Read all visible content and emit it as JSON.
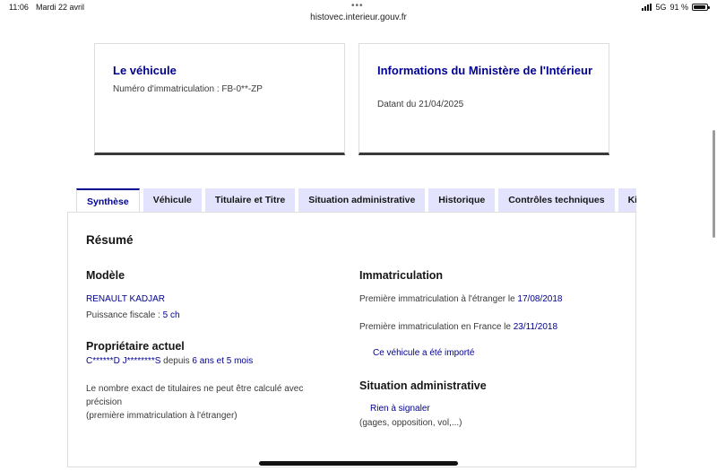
{
  "status_bar": {
    "time": "11:06",
    "date": "Mardi 22 avril",
    "network": "5G",
    "battery": "91 %",
    "battery_level": 0.91
  },
  "browser": {
    "url": "histovec.interieur.gouv.fr",
    "menu_dots": "•••"
  },
  "cards": {
    "vehicle": {
      "title": "Le véhicule",
      "plate": "Numéro d'immatriculation : FB-0**-ZP"
    },
    "ministry": {
      "title": "Informations du Ministère de l'Intérieur",
      "date": "Datant du 21/04/2025"
    }
  },
  "tabs": [
    {
      "label": "Synthèse",
      "active": true
    },
    {
      "label": "Véhicule",
      "active": false
    },
    {
      "label": "Titulaire et Titre",
      "active": false
    },
    {
      "label": "Situation administrative",
      "active": false
    },
    {
      "label": "Historique",
      "active": false
    },
    {
      "label": "Contrôles techniques",
      "active": false
    },
    {
      "label": "Kilo",
      "active": false
    }
  ],
  "summary": {
    "heading": "Résumé",
    "model": {
      "heading": "Modèle",
      "name": "RENAULT KADJAR",
      "power_label": "Puissance fiscale : ",
      "power_value": "5 ch"
    },
    "owner": {
      "heading": "Propriétaire actuel",
      "name": "C******D J********S",
      "since_label": " depuis ",
      "since_value": "6 ans et 5 mois",
      "note_line1": "Le nombre exact de titulaires ne peut être calculé avec",
      "note_line2": "précision",
      "note_line3": "(première immatriculation à l'étranger)"
    },
    "registration": {
      "heading": "Immatriculation",
      "foreign_label": "Première immatriculation à l'étranger le ",
      "foreign_date": "17/08/2018",
      "france_label": "Première immatriculation en France le ",
      "france_date": "23/11/2018",
      "imported": "Ce véhicule a été importé"
    },
    "admin": {
      "heading": "Situation administrative",
      "status": "Rien à signaler",
      "detail": "(gages, opposition, vol,...)"
    }
  }
}
